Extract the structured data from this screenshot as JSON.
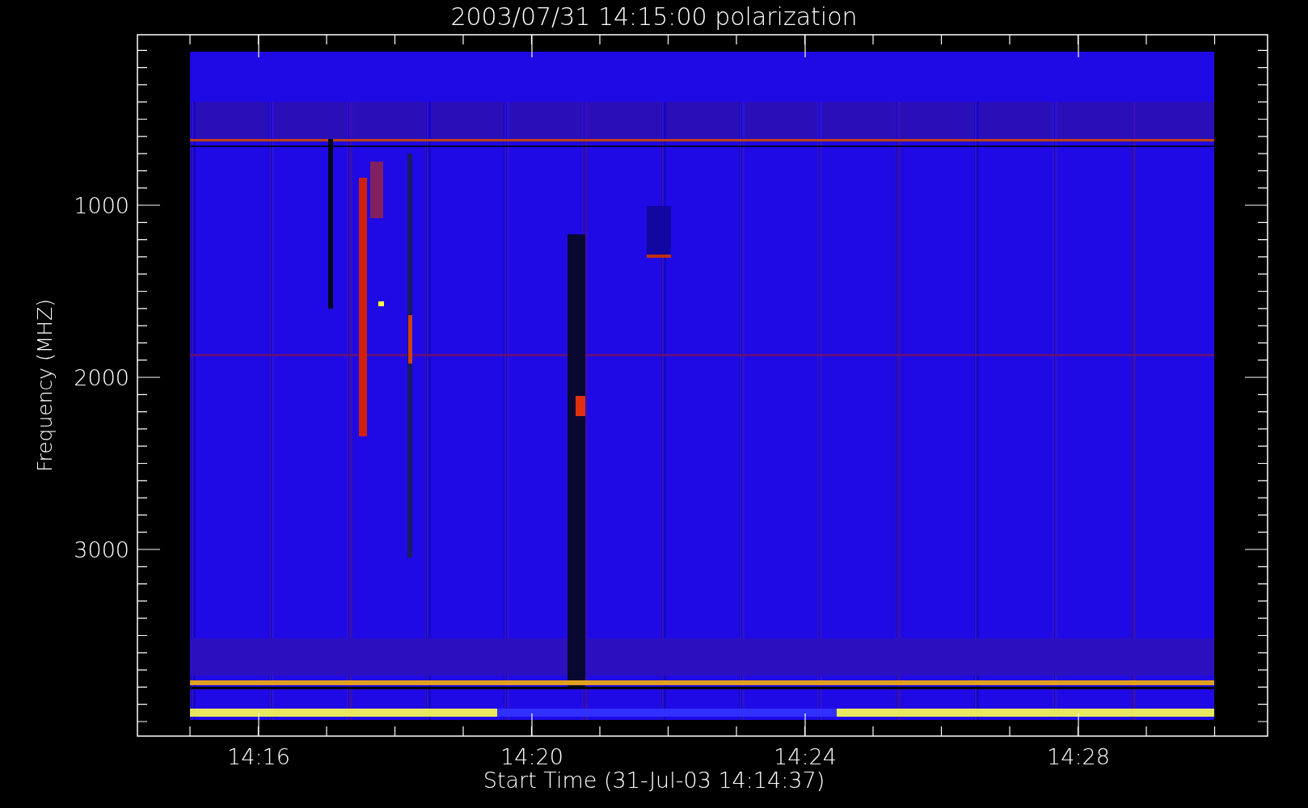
{
  "title": "2003/07/31 14:15:00 polarization",
  "x_axis": {
    "label": "Start Time (31-Jul-03 14:14:37)",
    "ticks": [
      "14:16",
      "14:20",
      "14:24",
      "14:28"
    ]
  },
  "y_axis": {
    "label": "Frequency (MHZ)",
    "ticks": [
      "1000",
      "2000",
      "3000"
    ]
  }
}
